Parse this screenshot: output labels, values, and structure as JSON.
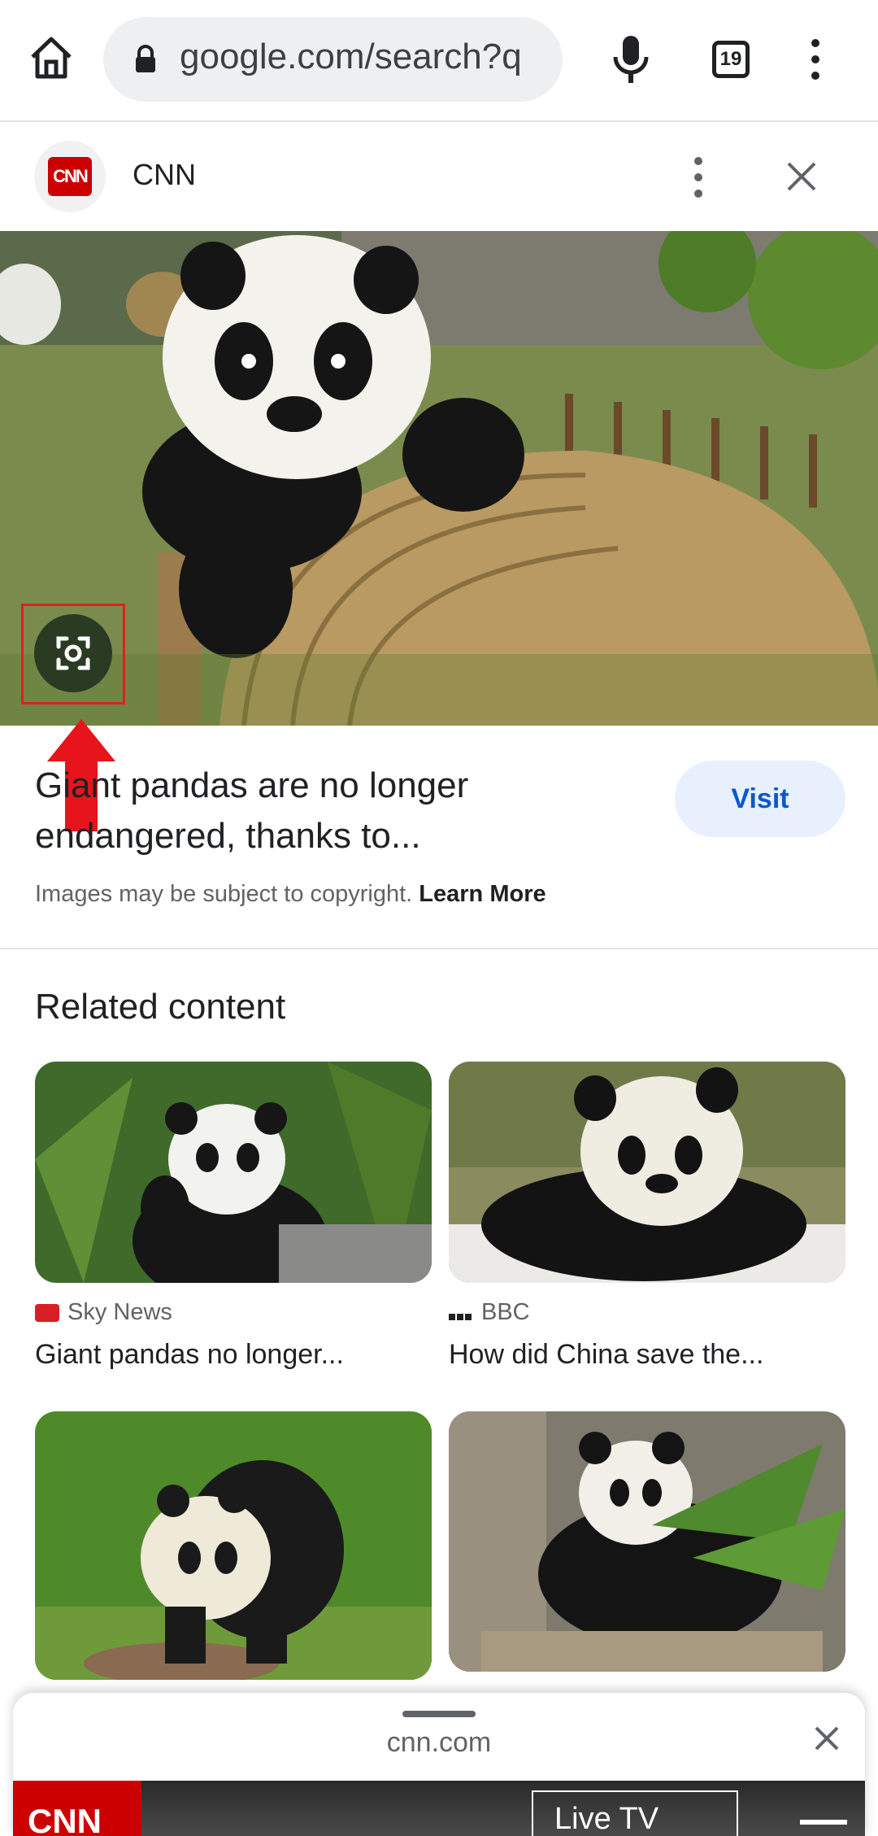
{
  "browser": {
    "url": "google.com/search?q",
    "tab_count": "19"
  },
  "source": {
    "name": "CNN",
    "logo_text": "CNN"
  },
  "result": {
    "title": "Giant pandas are no longer endangered, thanks to...",
    "visit_label": "Visit",
    "copyright_text": "Images may be subject to copyright.",
    "learn_more": "Learn More"
  },
  "related": {
    "heading": "Related content",
    "items": [
      {
        "source": "Sky News",
        "title": "Giant pandas no longer..."
      },
      {
        "source": "BBC",
        "title": "How did China save the..."
      },
      {
        "source": "",
        "title": ""
      },
      {
        "source": "",
        "title": ""
      }
    ]
  },
  "sheet": {
    "url": "cnn.com",
    "live_label": "Live TV",
    "logo_text": "CNN"
  },
  "colors": {
    "accent_blue": "#0b57d0",
    "visit_bg": "#e8f0fe",
    "cnn_red": "#cc0000",
    "highlight_red": "#e02020"
  },
  "icons": [
    "home-icon",
    "lock-icon",
    "mic-icon",
    "tabs-icon",
    "more-vert-icon",
    "close-icon",
    "google-lens-icon",
    "red-arrow-annotation"
  ]
}
